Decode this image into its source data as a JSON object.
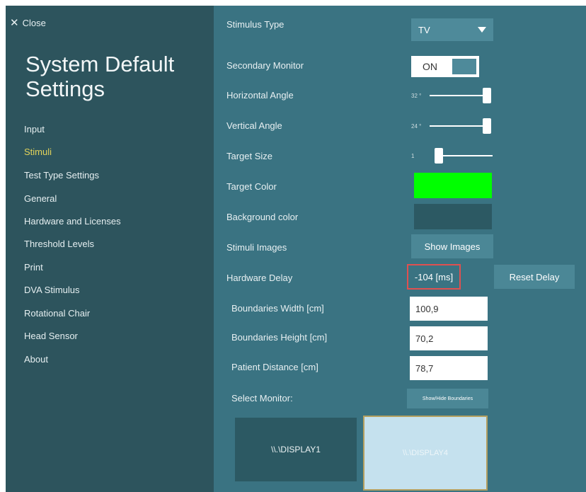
{
  "sidebar": {
    "close_label": "Close",
    "title": "System Default Settings",
    "items": [
      {
        "label": "Input",
        "active": false
      },
      {
        "label": "Stimuli",
        "active": true
      },
      {
        "label": "Test Type Settings",
        "active": false
      },
      {
        "label": "General",
        "active": false
      },
      {
        "label": "Hardware and Licenses",
        "active": false
      },
      {
        "label": "Threshold Levels",
        "active": false
      },
      {
        "label": "Print",
        "active": false
      },
      {
        "label": "DVA Stimulus",
        "active": false
      },
      {
        "label": "Rotational Chair",
        "active": false
      },
      {
        "label": "Head Sensor",
        "active": false
      },
      {
        "label": "About",
        "active": false
      }
    ],
    "active_color": "#e2d35a"
  },
  "settings": {
    "stimulus_type": {
      "label": "Stimulus Type",
      "value": "TV"
    },
    "secondary_monitor": {
      "label": "Secondary Monitor",
      "value": "ON"
    },
    "horizontal_angle": {
      "label": "Horizontal Angle",
      "value_text": "32 °",
      "level": 1.0
    },
    "vertical_angle": {
      "label": "Vertical Angle",
      "value_text": "24 °",
      "level": 1.0
    },
    "target_size": {
      "label": "Target Size",
      "value_text": "1",
      "level": 0.0
    },
    "target_color": {
      "label": "Target Color",
      "color": "#00ff00"
    },
    "background_color": {
      "label": "Background color",
      "color": "#2c5963"
    },
    "stimuli_images": {
      "label": "Stimuli Images",
      "button": "Show Images"
    },
    "hardware_delay": {
      "label": "Hardware Delay",
      "value": "-104 [ms]",
      "button": "Reset Delay"
    },
    "boundaries_width": {
      "label": "Boundaries Width  [cm]",
      "value": "100,9"
    },
    "boundaries_height": {
      "label": "Boundaries Height  [cm]",
      "value": "70,2"
    },
    "patient_distance": {
      "label": "Patient Distance  [cm]",
      "value": "78,7"
    },
    "select_monitor": {
      "label": "Select Monitor:",
      "button": "Show/Hide Boundaries"
    }
  },
  "monitors": [
    {
      "label": "\\\\.\\DISPLAY1",
      "selected": false
    },
    {
      "label": "\\\\.\\DISPLAY4",
      "selected": true
    }
  ]
}
